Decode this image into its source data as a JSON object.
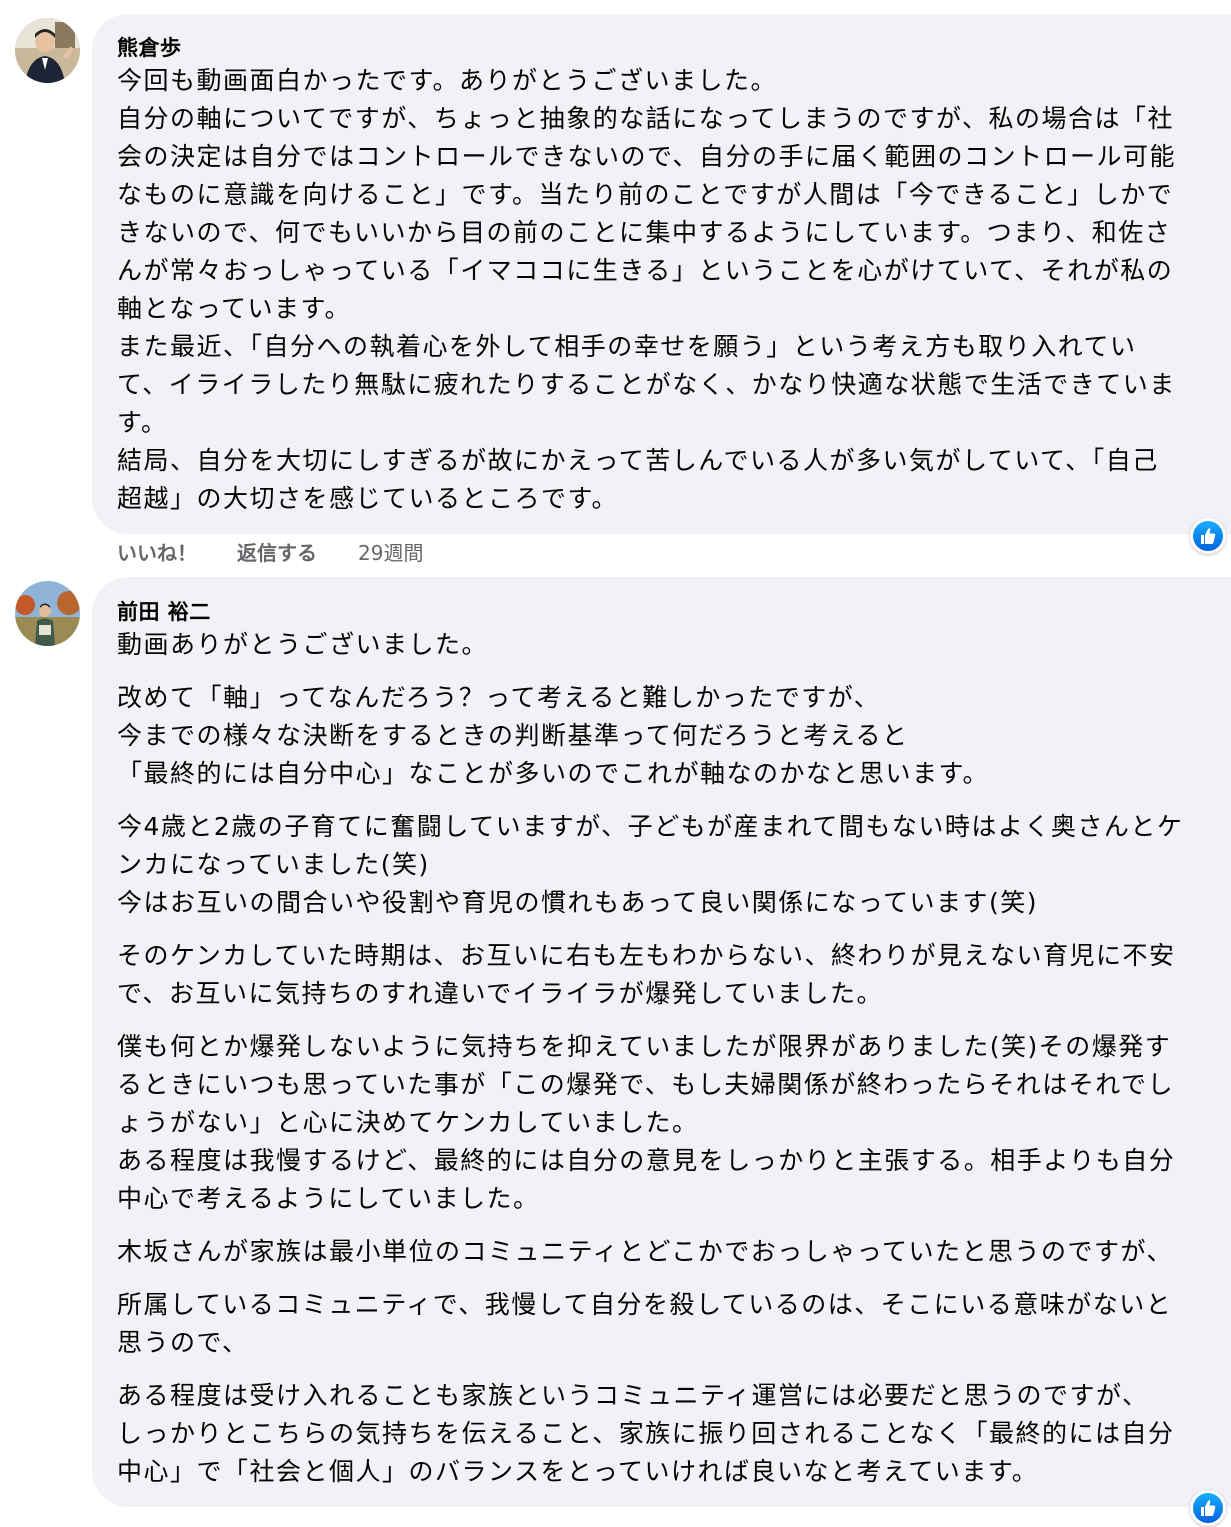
{
  "comments": [
    {
      "author": "熊倉歩",
      "lines": [
        "今回も動画面白かったです。ありがとうございました。",
        "自分の軸についてですが、ちょっと抽象的な話になってしまうのですが、私の場合は「社",
        "会の決定は自分ではコントロールできないので、自分の手に届く範囲のコントロール可能",
        "なものに意識を向けること」です。当たり前のことですが人間は「今できること」しかで",
        "きないので、何でもいいから目の前のことに集中するようにしています。つまり、和佐さ",
        "んが常々おっしゃっている「イマココに生きる」ということを心がけていて、それが私の",
        "軸となっています。",
        "また最近、「自分への執着心を外して相手の幸せを願う」という考え方も取り入れてい",
        "て、イライラしたり無駄に疲れたりすることがなく、かなり快適な状態で生活できていま",
        "す。",
        "結局、自分を大切にしすぎるが故にかえって苦しんでいる人が多い気がしていて、「自己",
        "超越」の大切さを感じているところです。"
      ],
      "actions": {
        "like": "いいね！",
        "reply": "返信する",
        "time": "29週間"
      },
      "reaction_icon": "thumbs-up-icon"
    },
    {
      "author": "前田 裕二",
      "lines": [
        "動画ありがとうございました。",
        "改めて「軸」ってなんだろう？って考えると難しかったですが、",
        "今までの様々な決断をするときの判断基準って何だろうと考えると",
        "「最終的には自分中心」なことが多いのでこれが軸なのかなと思います。",
        "今4歳と2歳の子育てに奮闘していますが、子どもが産まれて間もない時はよく奥さんとケ",
        "ンカになっていました(笑)",
        "今はお互いの間合いや役割や育児の慣れもあって良い関係になっています(笑)",
        "そのケンカしていた時期は、お互いに右も左もわからない、終わりが見えない育児に不安",
        "で、お互いに気持ちのすれ違いでイライラが爆発していました。",
        "僕も何とか爆発しないように気持ちを抑えていましたが限界がありました(笑)その爆発す",
        "るときにいつも思っていた事が「この爆発で、もし夫婦関係が終わったらそれはそれでし",
        "ょうがない」と心に決めてケンカしていました。",
        "ある程度は我慢するけど、最終的には自分の意見をしっかりと主張する。相手よりも自分",
        "中心で考えるようにしていました。",
        "木坂さんが家族は最小単位のコミュニティとどこかでおっしゃっていたと思うのですが、",
        "所属しているコミュニティで、我慢して自分を殺しているのは、そこにいる意味がないと",
        "思うので、",
        "ある程度は受け入れることも家族というコミュニティ運営には必要だと思うのですが、",
        "しっかりとこちらの気持ちを伝えること、家族に振り回されることなく「最終的には自分",
        "中心」で「社会と個人」のバランスをとっていければ良いなと考えています。"
      ],
      "reaction_icon": "thumbs-up-icon"
    }
  ],
  "colors": {
    "bubble": "#f0f2f5",
    "text": "#050505",
    "secondary_text": "#65676b",
    "like_blue": "#1877f2"
  }
}
